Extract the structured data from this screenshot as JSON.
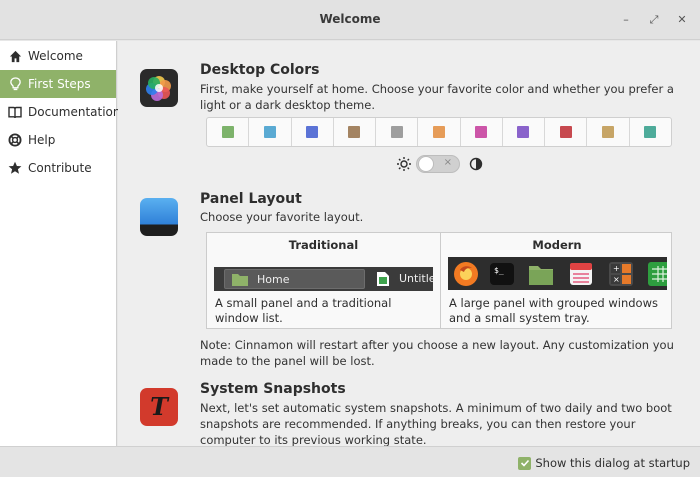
{
  "window": {
    "title": "Welcome",
    "minimize_glyph": "–",
    "maximize_glyph": "⤢",
    "close_glyph": "✕"
  },
  "sidebar": {
    "items": [
      {
        "label": "Welcome",
        "icon": "home-icon",
        "active": false
      },
      {
        "label": "First Steps",
        "icon": "lightbulb-icon",
        "active": true
      },
      {
        "label": "Documentation",
        "icon": "book-icon",
        "active": false
      },
      {
        "label": "Help",
        "icon": "lifebuoy-icon",
        "active": false
      },
      {
        "label": "Contribute",
        "icon": "star-icon",
        "active": false
      }
    ]
  },
  "main": {
    "desktop_colors": {
      "title": "Desktop Colors",
      "text": "First, make yourself at home. Choose your favorite color and whether you prefer a light or a dark desktop theme.",
      "icon": "color-palette-icon",
      "swatches": [
        "#7db36b",
        "#5aaad3",
        "#5b73d6",
        "#a48462",
        "#9e9e9e",
        "#e69c58",
        "#cc55a8",
        "#8a63cb",
        "#c7494f",
        "#c7a566",
        "#4eab9a"
      ],
      "theme_toggle": {
        "light_icon": "sun-icon",
        "dark_icon": "moon-icon",
        "off_mark": "×",
        "dark_enabled": false
      }
    },
    "panel_layout": {
      "title": "Panel Layout",
      "text": "Choose your favorite layout.",
      "icon": "panel-icon",
      "options": [
        {
          "name": "Traditional",
          "description": "A small panel and a traditional window list.",
          "preview": {
            "window1": "Home",
            "window2": "Untitled"
          }
        },
        {
          "name": "Modern",
          "description": "A large panel with grouped windows and a small system tray.",
          "preview_icons": [
            "firefox-icon",
            "terminal-icon",
            "folder-icon",
            "calendar-icon",
            "calculator-icon",
            "spreadsheet-icon"
          ]
        }
      ],
      "note": "Note: Cinnamon will restart after you choose a new layout. Any customization you made to the panel will be lost."
    },
    "system_snapshots": {
      "title": "System Snapshots",
      "text": "Next, let's set automatic system snapshots. A minimum of two daily and two boot snapshots are recommended. If anything breaks, you can then restore your computer to its previous working state.",
      "icon": "timeshift-icon",
      "icon_glyph": "T"
    }
  },
  "footer": {
    "show_at_startup_label": "Show this dialog at startup",
    "show_at_startup_checked": true
  }
}
